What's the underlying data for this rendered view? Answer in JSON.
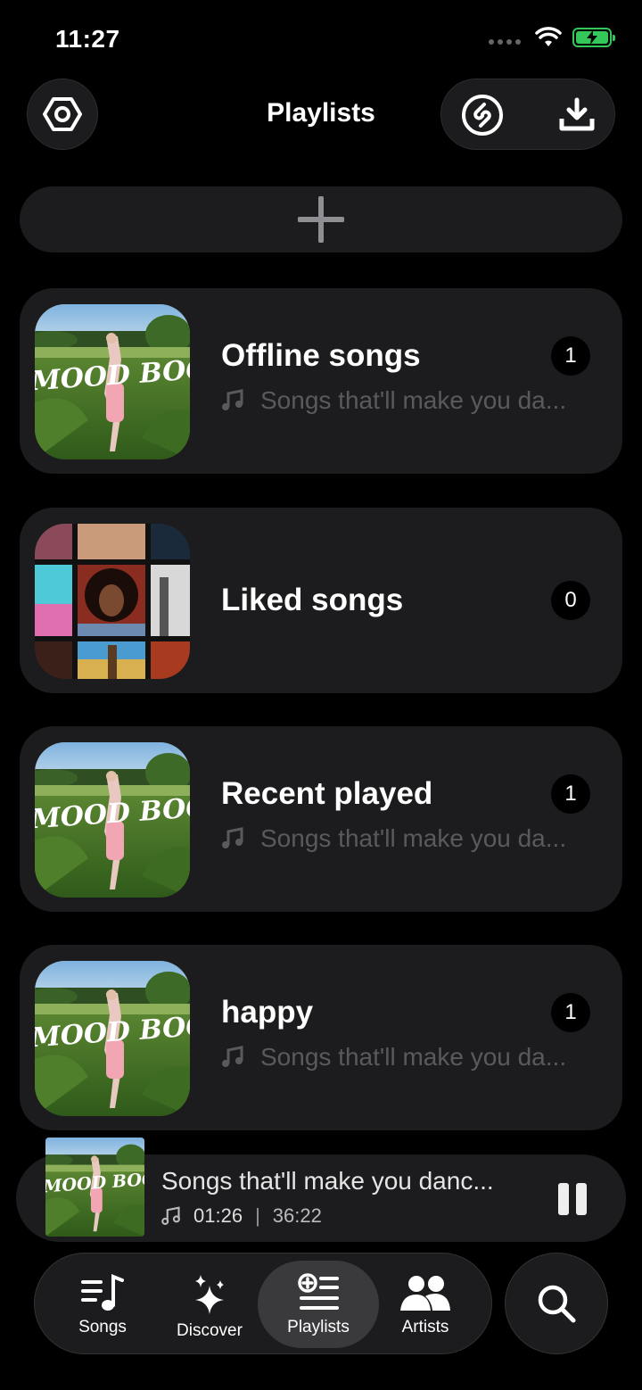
{
  "status_bar": {
    "time": "11:27",
    "battery_color": "#34c759"
  },
  "header": {
    "title": "Playlists",
    "icons": [
      "settings-hexagon-icon",
      "shazam-icon",
      "download-icon"
    ]
  },
  "add_button": {
    "icon": "plus-icon"
  },
  "playlists": [
    {
      "title": "Offline songs",
      "count": "1",
      "subtitle": "Songs that'll make you da...",
      "cover": "mood-booster"
    },
    {
      "title": "Liked songs",
      "count": "0",
      "subtitle": "",
      "cover": "collage"
    },
    {
      "title": "Recent played",
      "count": "1",
      "subtitle": "Songs that'll make you da...",
      "cover": "mood-booster"
    },
    {
      "title": "happy",
      "count": "1",
      "subtitle": "Songs that'll make you da...",
      "cover": "mood-booster"
    }
  ],
  "cover_art": {
    "text": "MOOD BOOSTER"
  },
  "now_playing": {
    "title": "Songs that'll make you danc...",
    "elapsed": "01:26",
    "separator": "|",
    "total": "36:22",
    "state": "playing"
  },
  "tab_bar": {
    "tabs": [
      {
        "label": "Songs",
        "icon": "music-list-icon"
      },
      {
        "label": "Discover",
        "icon": "sparkles-icon"
      },
      {
        "label": "Playlists",
        "icon": "playlist-add-icon",
        "active": true
      },
      {
        "label": "Artists",
        "icon": "people-icon"
      }
    ],
    "search_icon": "search-icon"
  },
  "colors": {
    "background": "#000000",
    "card": "#1c1c1e",
    "muted_text": "#5a5a5e",
    "active_tab": "#3a3a3c"
  }
}
